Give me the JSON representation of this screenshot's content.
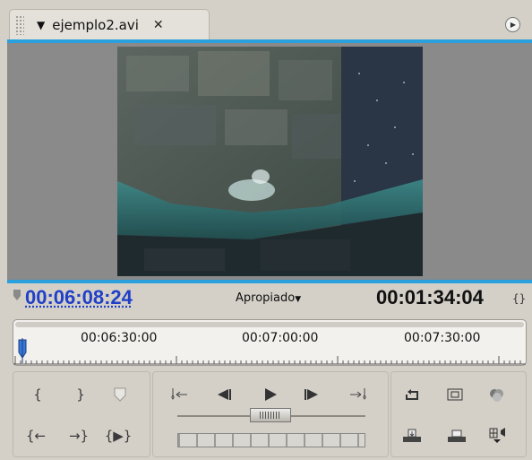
{
  "tab": {
    "title": "ejemplo2.avi",
    "close_glyph": "✕",
    "dropdown_icon": "triangle-down-icon",
    "menu_icon": "panel-menu-icon"
  },
  "colors": {
    "accent": "#2aa0dc",
    "timecode_current": "#2040c8",
    "background": "#d4d0c8",
    "monitor": "#8a8a8a"
  },
  "timecodes": {
    "current": "00:06:08:24",
    "duration": "00:01:34:04",
    "zoom": "Apropiado"
  },
  "ruler": {
    "labels": [
      "00:06:30:00",
      "00:07:00:00",
      "00:07:30:00"
    ]
  },
  "controls": {
    "left_row1": [
      "mark-in-icon",
      "mark-out-icon",
      "set-marker-icon"
    ],
    "left_row2": [
      "go-to-in-icon",
      "go-to-out-icon",
      "play-in-to-out-icon"
    ],
    "center_row1": [
      "go-to-previous-marker-icon",
      "step-back-icon",
      "play-icon",
      "step-forward-icon",
      "go-to-next-marker-icon"
    ],
    "right_row1": [
      "loop-icon",
      "safe-margins-icon",
      "output-icon"
    ],
    "right_row2": [
      "insert-icon",
      "overlay-icon",
      "export-frame-icon"
    ]
  }
}
